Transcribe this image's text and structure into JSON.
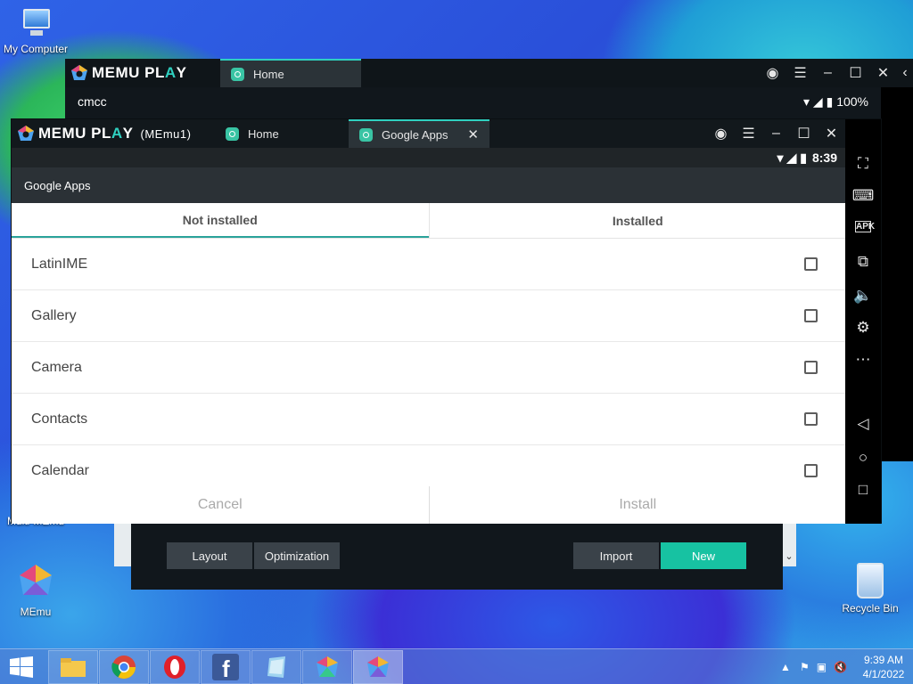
{
  "desktop": {
    "icons": [
      {
        "label": "My Computer"
      },
      {
        "label": "Multi-MEmu"
      },
      {
        "label": "MEmu"
      },
      {
        "label": "Recycle Bin"
      }
    ]
  },
  "back_window": {
    "logo_text": "MEMU PL",
    "logo_text_hl": "A",
    "logo_text_end": "Y",
    "tab_home": "Home",
    "carrier": "cmcc",
    "battery": "100%"
  },
  "front_window": {
    "logo_text": "MEMU PL",
    "logo_text_hl": "A",
    "logo_text_end": "Y",
    "instance": "(MEmu1)",
    "tabs": [
      {
        "label": "Home"
      },
      {
        "label": "Google Apps"
      }
    ],
    "android": {
      "time": "8:39",
      "appbar_title": "Google Apps",
      "tabs": [
        {
          "label": "Not installed"
        },
        {
          "label": "Installed"
        }
      ],
      "apps": [
        {
          "name": "LatinIME"
        },
        {
          "name": "Gallery"
        },
        {
          "name": "Camera"
        },
        {
          "name": "Contacts"
        },
        {
          "name": "Calendar"
        }
      ],
      "cancel": "Cancel",
      "install": "Install"
    }
  },
  "multi_memu": {
    "layout": "Layout",
    "optimization": "Optimization",
    "import": "Import",
    "new": "New",
    "accent": "#17c2a2"
  },
  "taskbar": {
    "time": "9:39 AM",
    "date": "4/1/2022"
  }
}
